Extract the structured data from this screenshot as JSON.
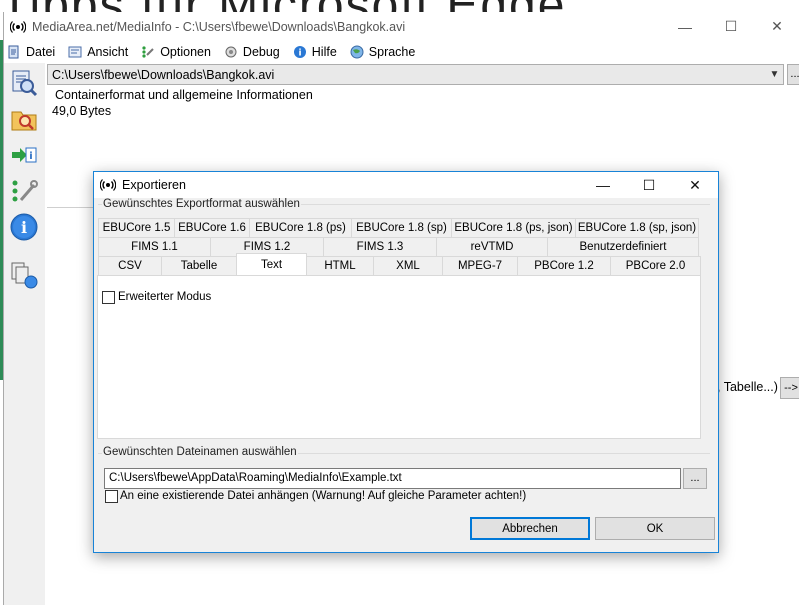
{
  "background_text": "Tipps für Microsoft Edge",
  "window": {
    "title": "MediaArea.net/MediaInfo - C:\\Users\\fbewe\\Downloads\\Bangkok.avi",
    "minimize": "—",
    "maximize": "☐",
    "close": "✕"
  },
  "menu": [
    {
      "label": "Datei",
      "icon": "file-icon"
    },
    {
      "label": "Ansicht",
      "icon": "view-icon"
    },
    {
      "label": "Optionen",
      "icon": "options-icon"
    },
    {
      "label": "Debug",
      "icon": "debug-icon"
    },
    {
      "label": "Hilfe",
      "icon": "help-icon"
    },
    {
      "label": "Sprache",
      "icon": "language-icon"
    }
  ],
  "sidebar": [
    "open-file-icon",
    "open-folder-icon",
    "export-icon",
    "preferences-icon",
    "info-icon",
    "batch-icon"
  ],
  "file_select": {
    "value": "C:\\Users\\fbewe\\Downloads\\Bangkok.avi",
    "more": "..."
  },
  "info": {
    "title": "Containerformat und allgemeine Informationen",
    "size": "49,0 Bytes",
    "side_text": ", Tabelle...)",
    "arrow": "-->"
  },
  "dialog": {
    "title": "Exportieren",
    "minimize": "—",
    "maximize": "☐",
    "close": "✕",
    "format_group": "Gewünschtes Exportformat auswählen",
    "tabs_row1": [
      "EBUCore 1.5",
      "EBUCore 1.6",
      "EBUCore 1.8 (ps)",
      "EBUCore 1.8 (sp)",
      "EBUCore 1.8 (ps, json)",
      "EBUCore 1.8 (sp, json)"
    ],
    "tabs_row2": [
      "FIMS 1.1",
      "FIMS 1.2",
      "FIMS 1.3",
      "reVTMD",
      "Benutzerdefiniert"
    ],
    "tabs_row3": [
      "CSV",
      "Tabelle",
      "Text",
      "HTML",
      "XML",
      "MPEG-7",
      "PBCore 1.2",
      "PBCore 2.0"
    ],
    "active_tab": "Text",
    "advanced_mode": "Erweiterter Modus",
    "filename_group": "Gewünschten Dateinamen auswählen",
    "path": "C:\\Users\\fbewe\\AppData\\Roaming\\MediaInfo\\Example.txt",
    "path_more": "...",
    "append_label": "An eine existierende Datei anhängen (Warnung! Auf gleiche Parameter achten!)",
    "cancel": "Abbrechen",
    "ok": "OK"
  }
}
